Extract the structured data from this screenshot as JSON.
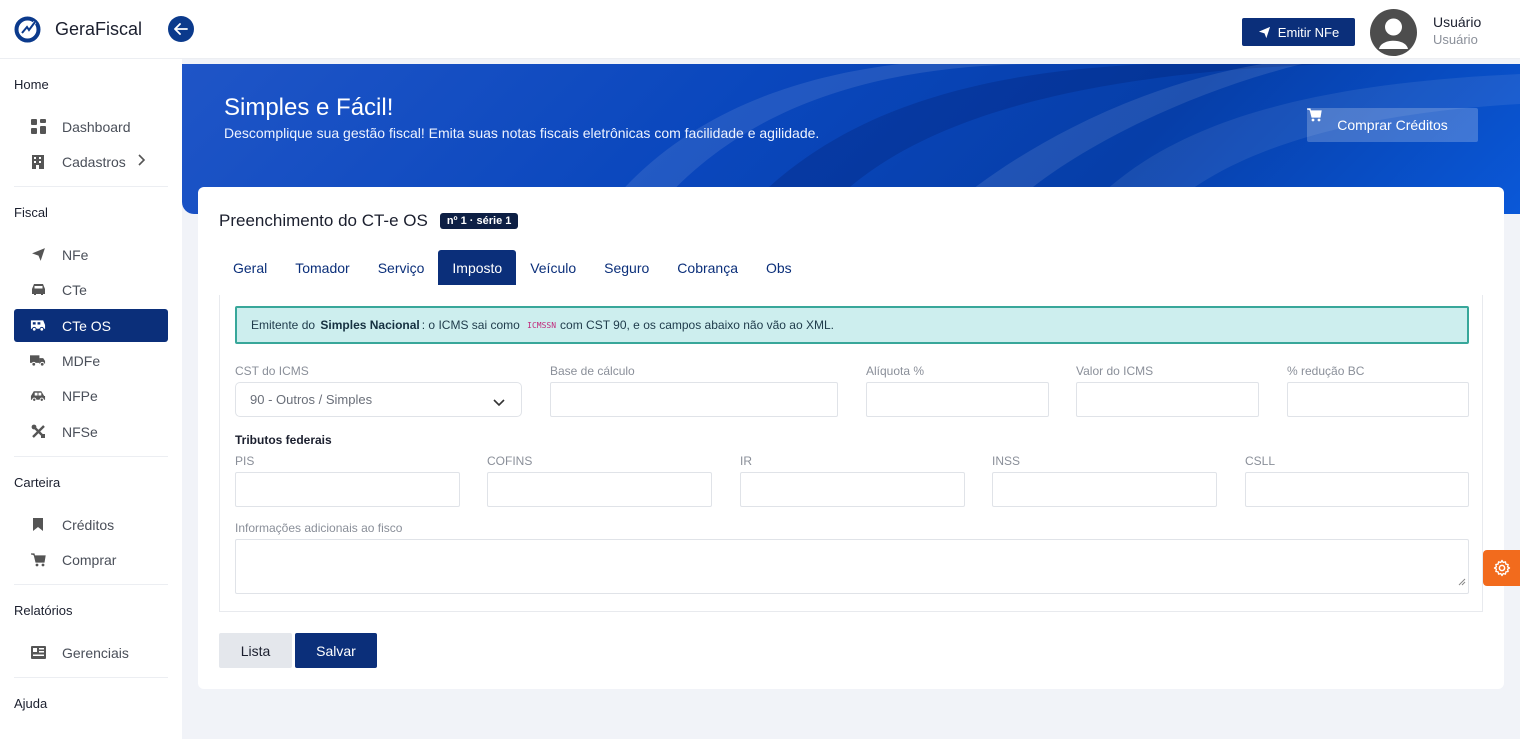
{
  "header": {
    "brand": "GeraFiscal",
    "emit_label": "Emitir NFe",
    "user_name": "Usuário",
    "user_role": "Usuário"
  },
  "sidebar": {
    "sections": [
      {
        "title": "Home",
        "items": [
          {
            "label": "Dashboard",
            "icon": "dashboard-icon"
          },
          {
            "label": "Cadastros",
            "icon": "building-icon"
          }
        ]
      },
      {
        "title": "Fiscal",
        "items": [
          {
            "label": "NFe",
            "icon": "paper-plane-icon"
          },
          {
            "label": "CTe",
            "icon": "car-icon"
          },
          {
            "label": "CTe OS",
            "icon": "van-icon",
            "active": true
          },
          {
            "label": "MDFe",
            "icon": "truck-icon"
          },
          {
            "label": "NFPe",
            "icon": "car-side-icon"
          },
          {
            "label": "NFSe",
            "icon": "tools-icon"
          }
        ]
      },
      {
        "title": "Carteira",
        "items": [
          {
            "label": "Créditos",
            "icon": "bookmark-icon"
          },
          {
            "label": "Comprar",
            "icon": "cart-icon"
          }
        ]
      },
      {
        "title": "Relatórios",
        "items": [
          {
            "label": "Gerenciais",
            "icon": "report-icon"
          }
        ]
      },
      {
        "title": "Ajuda",
        "items": []
      }
    ]
  },
  "hero": {
    "title": "Simples e Fácil!",
    "subtitle": "Descomplique sua gestão fiscal! Emita suas notas fiscais eletrônicas com facilidade e agilidade.",
    "buy_label": "Comprar Créditos"
  },
  "form": {
    "title": "Preenchimento do CT-e OS",
    "badge": "nº 1 · série 1",
    "tabs": [
      "Geral",
      "Tomador",
      "Serviço",
      "Imposto",
      "Veículo",
      "Seguro",
      "Cobrança",
      "Obs"
    ],
    "active_tab": "Imposto",
    "alert": {
      "prefix": "Emitente do",
      "bold": "Simples Nacional",
      "middle": ": o ICMS sai como",
      "code": "ICMSSN",
      "suffix": "com CST 90, e os campos abaixo não vão ao XML."
    },
    "icms_fields": {
      "cst_label": "CST do ICMS",
      "cst_value": "90 - Outros / Simples",
      "base_label": "Base de cálculo",
      "aliquota_label": "Alíquota %",
      "valor_label": "Valor do ICMS",
      "reducao_label": "% redução BC"
    },
    "federal_title": "Tributos federais",
    "federal_fields": [
      "PIS",
      "COFINS",
      "IR",
      "INSS",
      "CSLL"
    ],
    "info_label": "Informações adicionais ao fisco",
    "btn_lista": "Lista",
    "btn_salvar": "Salvar"
  },
  "colors": {
    "primary": "#0b2f7a",
    "accent": "#f26b1d",
    "alert_bg": "#cdeeee",
    "alert_border": "#38a79a"
  }
}
